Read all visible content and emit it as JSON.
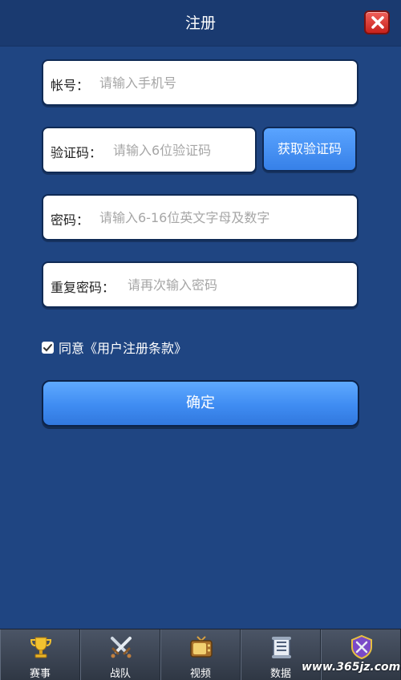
{
  "header": {
    "title": "注册"
  },
  "fields": {
    "account": {
      "label": "帐号：",
      "placeholder": "请输入手机号"
    },
    "code": {
      "label": "验证码：",
      "placeholder": "请输入6位验证码"
    },
    "password": {
      "label": "密码：",
      "placeholder": "请输入6-16位英文字母及数字"
    },
    "repeat": {
      "label": "重复密码：",
      "placeholder": "请再次输入密码"
    }
  },
  "get_code_label": "获取验证码",
  "agreement": {
    "checked": true,
    "text": "同意《用户注册条款》"
  },
  "confirm_label": "确定",
  "tabbar": {
    "items": [
      {
        "label": "赛事",
        "icon": "trophy-icon"
      },
      {
        "label": "战队",
        "icon": "crossed-swords-icon"
      },
      {
        "label": "视频",
        "icon": "tv-icon"
      },
      {
        "label": "数据",
        "icon": "scroll-icon"
      },
      {
        "label": "",
        "icon": "shield-icon"
      }
    ]
  },
  "watermark": "www.365jz.com",
  "colors": {
    "background": "#1f4582",
    "accent": "#3f8cf2",
    "close": "#d9302a"
  }
}
